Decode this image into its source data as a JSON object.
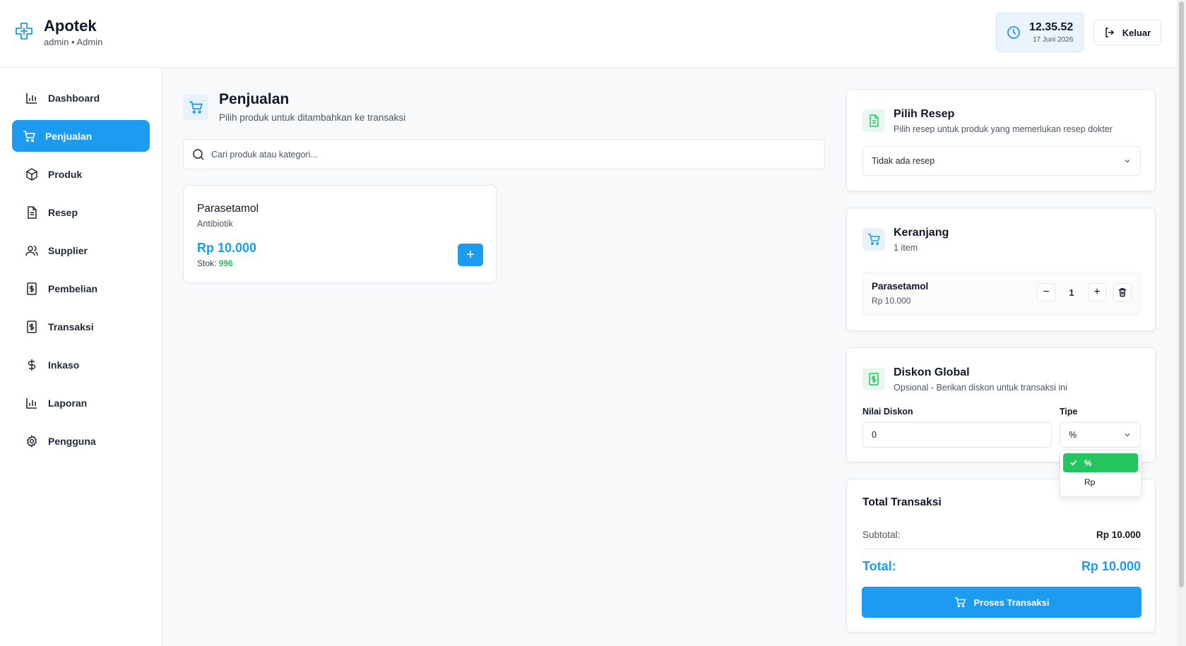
{
  "app": {
    "title": "Apotek",
    "user": "admin • Admin"
  },
  "clock": {
    "time": "12.35.52",
    "date": "17 Juni 2026"
  },
  "logout_label": "Keluar",
  "sidebar": {
    "items": [
      {
        "label": "Dashboard",
        "icon": "bar-chart-icon"
      },
      {
        "label": "Penjualan",
        "icon": "cart-icon",
        "active": true
      },
      {
        "label": "Produk",
        "icon": "package-icon"
      },
      {
        "label": "Resep",
        "icon": "document-icon"
      },
      {
        "label": "Supplier",
        "icon": "users-icon"
      },
      {
        "label": "Pembelian",
        "icon": "dollar-receipt-icon"
      },
      {
        "label": "Transaksi",
        "icon": "dollar-receipt-icon"
      },
      {
        "label": "Inkaso",
        "icon": "dollar-icon"
      },
      {
        "label": "Laporan",
        "icon": "bar-chart-icon"
      },
      {
        "label": "Pengguna",
        "icon": "gear-icon"
      }
    ]
  },
  "page": {
    "title": "Penjualan",
    "subtitle": "Pilih produk untuk ditambahkan ke transaksi"
  },
  "search": {
    "placeholder": "Cari produk atau kategori..."
  },
  "products": [
    {
      "name": "Parasetamol",
      "category": "Antibiotik",
      "price": "Rp 10.000",
      "stock_label": "Stok:",
      "stock": "996",
      "add_label": "+"
    }
  ],
  "resep": {
    "title": "Pilih Resep",
    "subtitle": "Pilih resep untuk produk yang memerlukan resep dokter",
    "selected": "Tidak ada resep"
  },
  "cart": {
    "title": "Keranjang",
    "count": "1 item",
    "items": [
      {
        "name": "Parasetamol",
        "price": "Rp 10.000",
        "qty": "1"
      }
    ],
    "minus": "−",
    "plus": "+"
  },
  "discount": {
    "title": "Diskon Global",
    "subtitle": "Opsional - Berikan diskon untuk transaksi ini",
    "value_label": "Nilai Diskon",
    "value": "0",
    "type_label": "Tipe",
    "type_selected": "%",
    "type_options": [
      "%",
      "Rp"
    ]
  },
  "total": {
    "title": "Total Transaksi",
    "subtotal_label": "Subtotal:",
    "subtotal": "Rp 10.000",
    "total_label": "Total:",
    "total": "Rp 10.000",
    "button_label": "Proses Transaksi"
  },
  "colors": {
    "primary": "#1d9bf0",
    "success": "#22c55e"
  }
}
